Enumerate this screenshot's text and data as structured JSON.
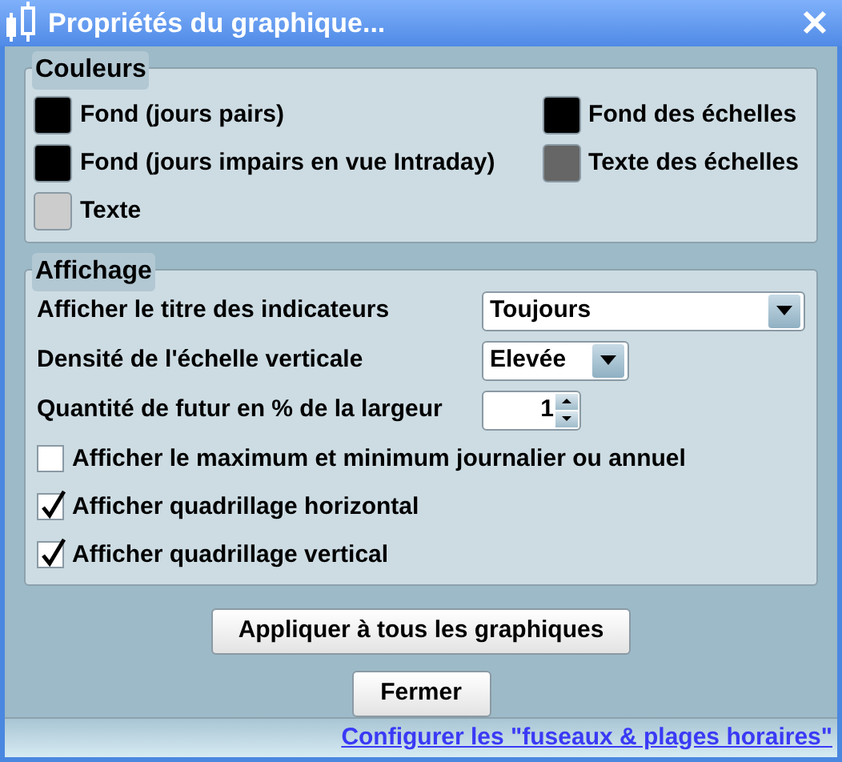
{
  "window": {
    "title": "Propriétés du graphique..."
  },
  "colors": {
    "title": "Couleurs",
    "items": [
      {
        "label": "Fond (jours pairs)",
        "color": "#000000"
      },
      {
        "label": "Fond des échelles",
        "color": "#000000"
      },
      {
        "label": "Fond (jours impairs en vue Intraday)",
        "color": "#000000"
      },
      {
        "label": "Texte des échelles",
        "color": "#666666"
      },
      {
        "label": "Texte",
        "color": "#cccccc"
      }
    ]
  },
  "display": {
    "title": "Affichage",
    "rows": [
      {
        "kind": "select",
        "label": "Afficher le titre des indicateurs",
        "value": "Toujours"
      },
      {
        "kind": "select",
        "label": "Densité de l'échelle verticale",
        "value": "Elevée"
      },
      {
        "kind": "spinner",
        "label": "Quantité de futur en % de la largeur",
        "value": "1"
      },
      {
        "kind": "checkbox",
        "label": "Afficher le maximum et minimum journalier ou annuel",
        "checked": false
      },
      {
        "kind": "checkbox",
        "label": "Afficher quadrillage horizontal",
        "checked": true
      },
      {
        "kind": "checkbox",
        "label": "Afficher quadrillage vertical",
        "checked": true
      }
    ]
  },
  "buttons": [
    "Appliquer à tous les graphiques",
    "Fermer"
  ],
  "footer_link": "Configurer les \"fuseaux & plages horaires\""
}
